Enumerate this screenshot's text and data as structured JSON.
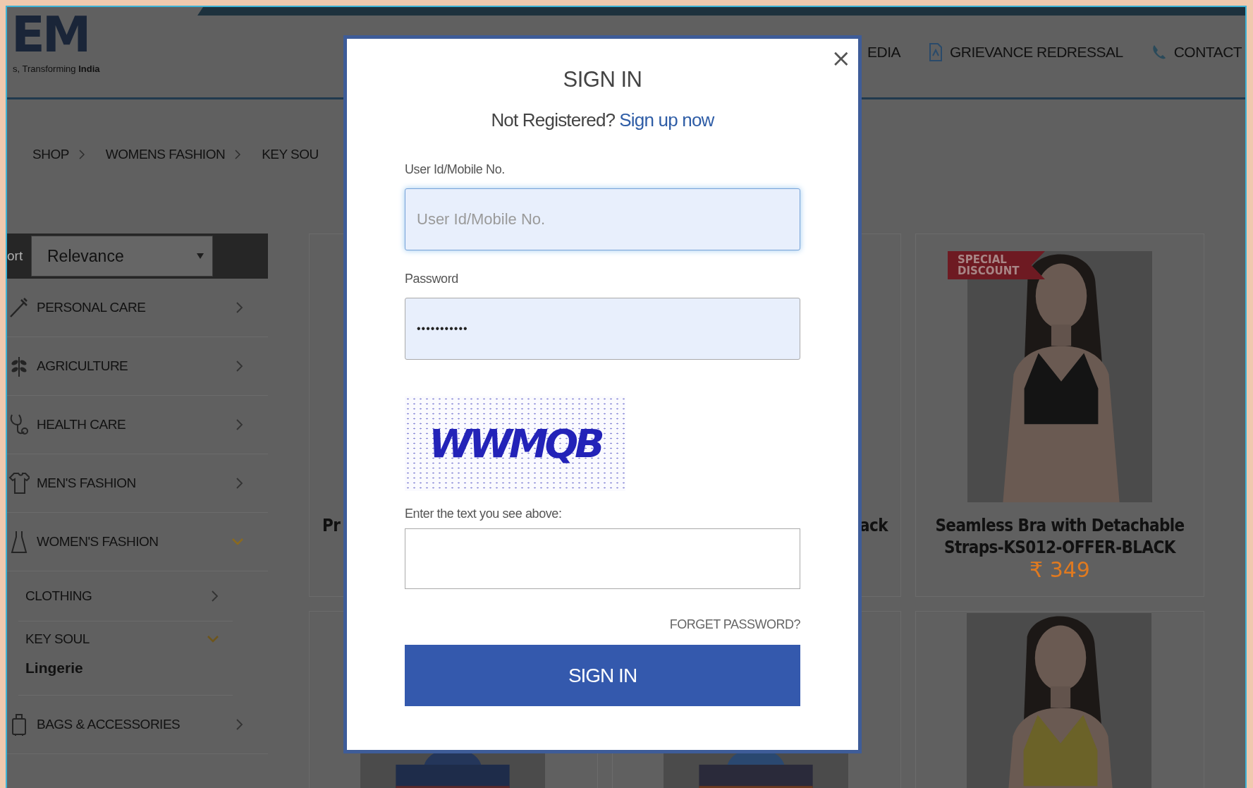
{
  "header": {
    "logo": "EM",
    "tagline": "s, Transforming **India**"
  },
  "nav": [
    {
      "label": "EDIA"
    },
    {
      "label": "GRIEVANCE REDRESSAL"
    },
    {
      "label": "CONTACT"
    }
  ],
  "breadcrumb": [
    "SHOP",
    "WOMENS FASHION",
    "KEY SOU"
  ],
  "sort": {
    "label": "ort",
    "value": "Relevance"
  },
  "categories": [
    {
      "label": "PERSONAL CARE",
      "expanded": false
    },
    {
      "label": "AGRICULTURE",
      "expanded": false
    },
    {
      "label": "HEALTH CARE",
      "expanded": false
    },
    {
      "label": "MEN'S FASHION",
      "expanded": false
    },
    {
      "label": "WOMEN'S FASHION",
      "expanded": true,
      "children": [
        {
          "label": "CLOTHING",
          "expanded": false
        },
        {
          "label": "KEY SOUL",
          "expanded": true,
          "children": [
            {
              "label": "Lingerie",
              "selected": true
            }
          ]
        }
      ]
    },
    {
      "label": "BAGS & ACCESSORIES",
      "expanded": false
    }
  ],
  "products": [
    {
      "title": "Pr"
    },
    {
      "title": "ack"
    },
    {
      "badge": "SPECIAL DISCOUNT",
      "title": "Seamless Bra with Detachable Straps-KS012-OFFER-BLACK",
      "price": "₹ 349",
      "image": {
        "kind": "picture"
      }
    },
    {
      "image": {
        "kind": "picture"
      }
    },
    {
      "image": {
        "kind": "picture"
      }
    },
    {
      "image": {
        "kind": "picture"
      }
    }
  ],
  "sign_in_dialog": {
    "close": "×",
    "title": "SIGN IN",
    "prompt": "Not Registered?",
    "signup_link": "Sign up now",
    "fields": [
      {
        "kind": "text",
        "label": "User Id/Mobile No.",
        "placeholder": "User Id/Mobile No.",
        "focused": true
      },
      {
        "kind": "password",
        "label": "Password",
        "value": "•••••••••••",
        "focused": false
      }
    ],
    "captcha": {
      "text": "WWMQB"
    },
    "captcha_field": {
      "label": "Enter the text you see above:"
    },
    "forgot_link": "FORGET PASSWORD?",
    "submit": "SIGN IN"
  }
}
